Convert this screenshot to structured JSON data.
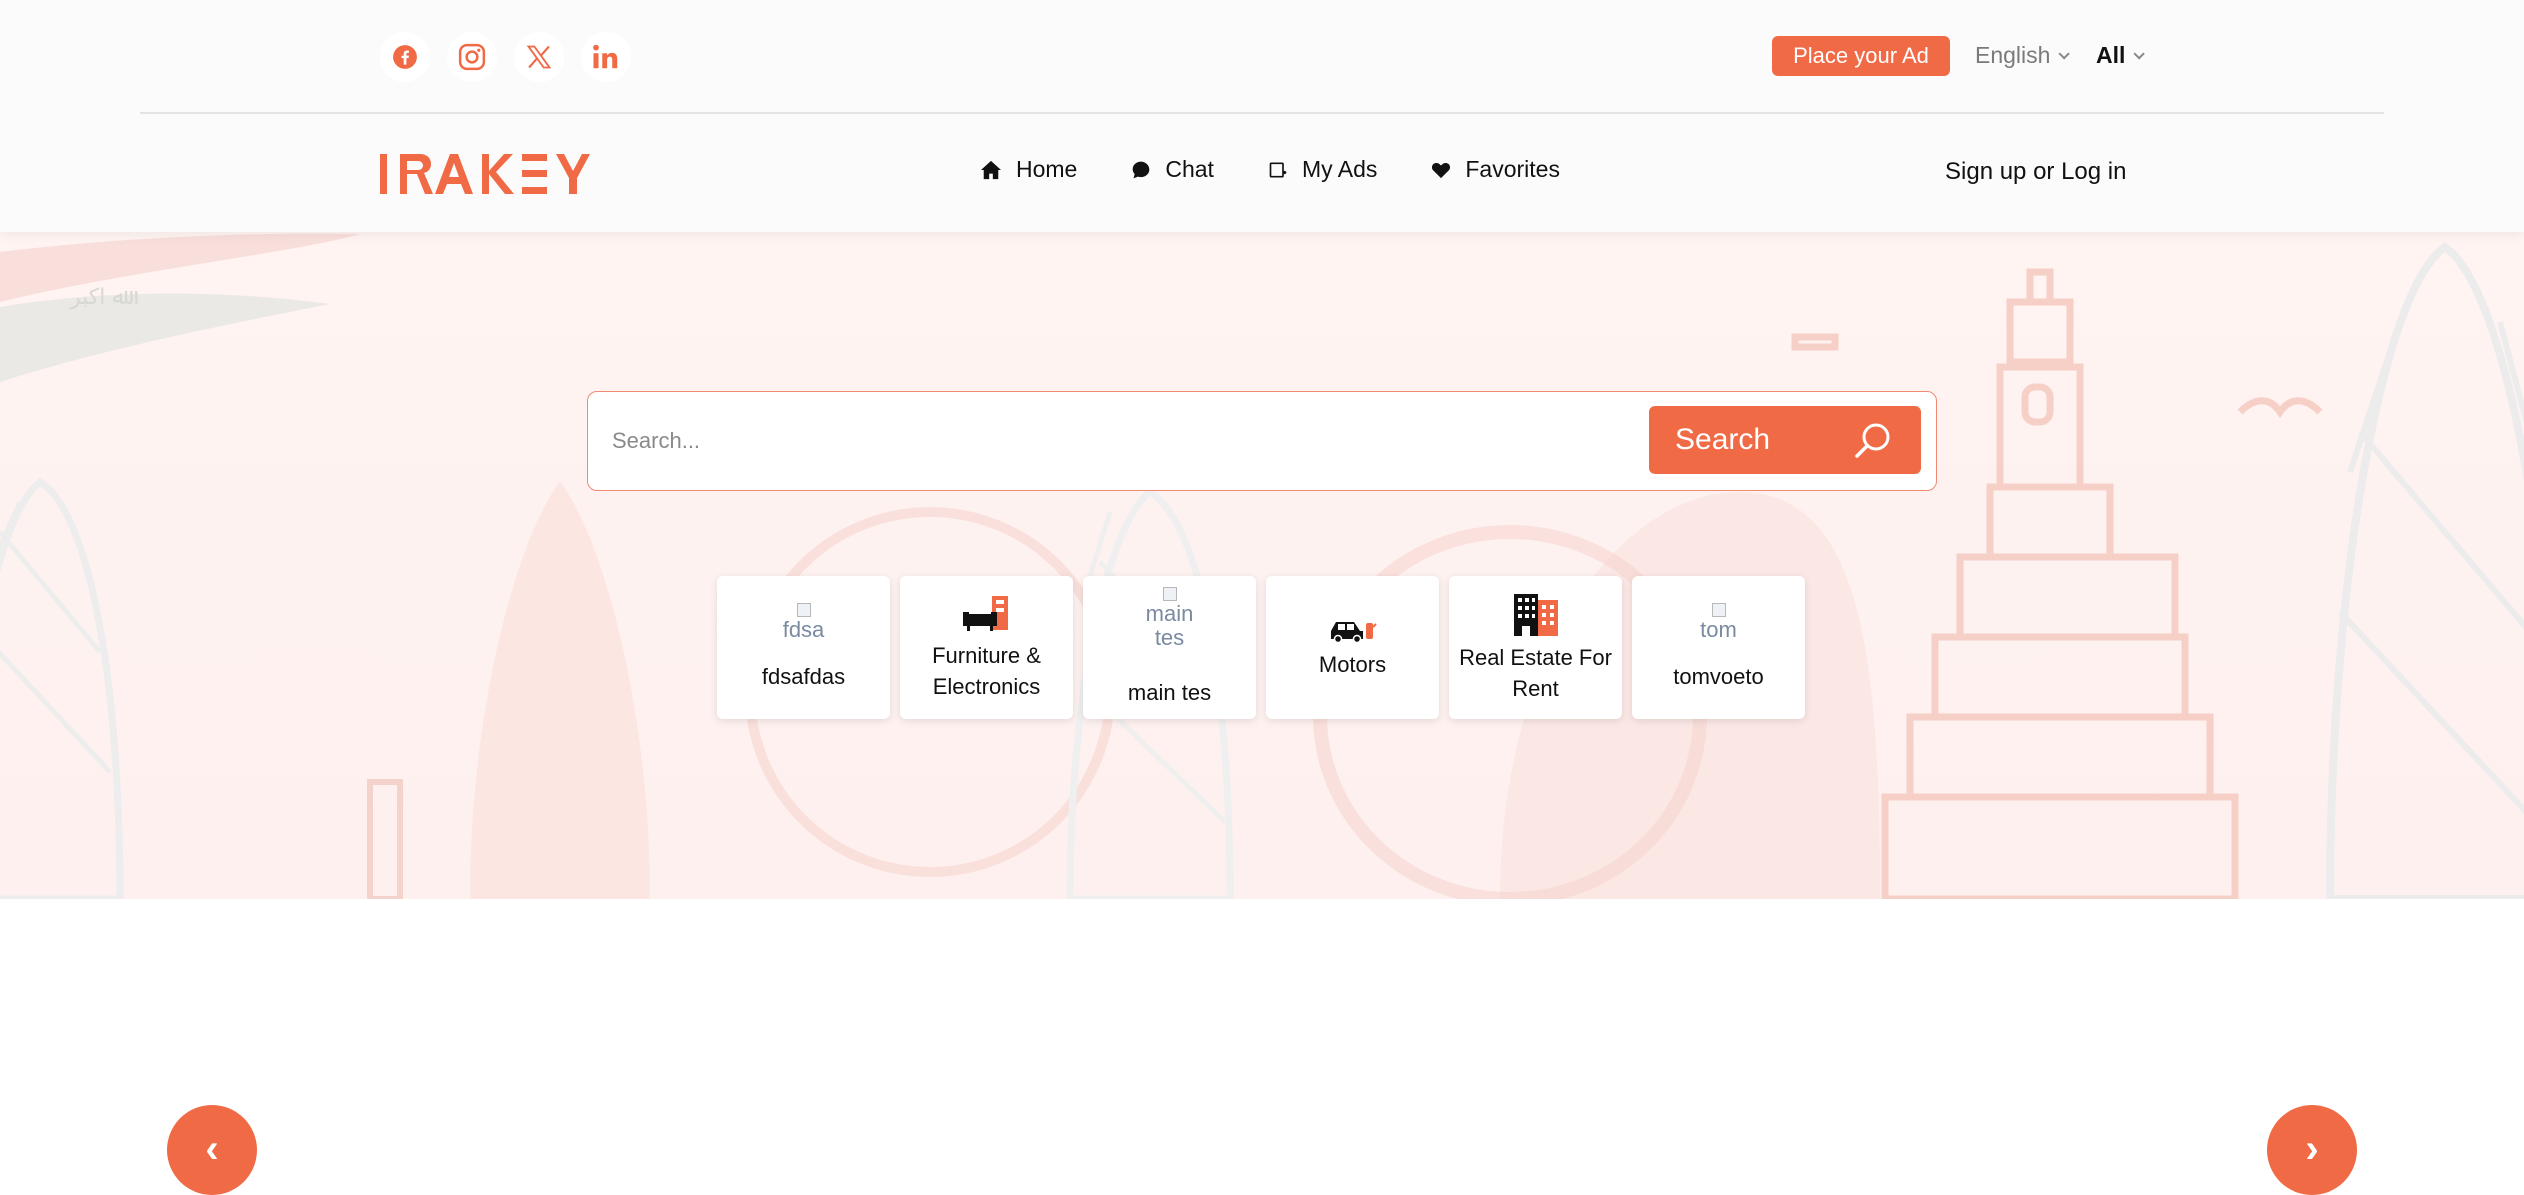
{
  "topbar": {
    "social": [
      "facebook-icon",
      "instagram-icon",
      "x-icon",
      "linkedin-icon"
    ],
    "place_ad": "Place your Ad",
    "language": "English",
    "region": "All"
  },
  "brand": {
    "logo_text": "IRAKEY",
    "accent": "#f06a46"
  },
  "nav": {
    "items": [
      {
        "label": "Home",
        "icon": "home-icon"
      },
      {
        "label": "Chat",
        "icon": "chat-icon"
      },
      {
        "label": "My Ads",
        "icon": "my-ads-icon"
      },
      {
        "label": "Favorites",
        "icon": "heart-icon"
      }
    ],
    "signin": "Sign up or Log in"
  },
  "search": {
    "placeholder": "Search...",
    "button": "Search"
  },
  "categories": [
    {
      "label": "fdsafdas",
      "img_alt": "fdsa"
    },
    {
      "label": "Furniture & Electronics",
      "icon": "furniture-icon"
    },
    {
      "label": "main tes",
      "img_alt": "main tes"
    },
    {
      "label": "Motors",
      "icon": "car-icon"
    },
    {
      "label": "Real Estate For Rent",
      "icon": "building-icon"
    },
    {
      "label": "tomvoeto",
      "img_alt": "tom"
    }
  ],
  "carousel": {
    "prev": "‹",
    "next": "›"
  }
}
